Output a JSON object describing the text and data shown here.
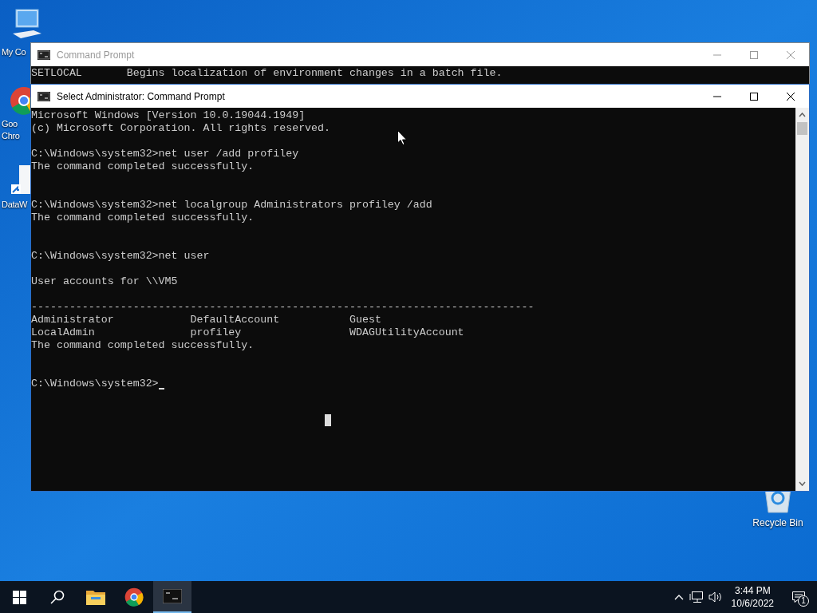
{
  "desktop_icons": [
    {
      "label": "My Co",
      "kind": "computer"
    },
    {
      "label": "Goo\nChro",
      "kind": "chrome"
    },
    {
      "label": "DataW",
      "kind": "file"
    },
    {
      "label": "Recycle Bin",
      "kind": "recycle"
    }
  ],
  "back_window": {
    "title": "Command Prompt",
    "lines": [
      "SETLOCAL       Begins localization of environment changes in a batch file."
    ]
  },
  "front_window": {
    "title": "Select Administrator: Command Prompt",
    "lines": [
      {
        "kind": "text",
        "text": "Microsoft Windows [Version 10.0.19044.1949]"
      },
      {
        "kind": "text",
        "text": "(c) Microsoft Corporation. All rights reserved."
      },
      {
        "kind": "blank"
      },
      {
        "kind": "text",
        "text": "C:\\Windows\\system32>net user /add profiley"
      },
      {
        "kind": "text",
        "text": "The command completed successfully."
      },
      {
        "kind": "blank"
      },
      {
        "kind": "blank"
      },
      {
        "kind": "text",
        "text": "C:\\Windows\\system32>net localgroup Administrators profiley /add"
      },
      {
        "kind": "text",
        "text": "The command completed successfully."
      },
      {
        "kind": "blank"
      },
      {
        "kind": "blank"
      },
      {
        "kind": "text",
        "text": "C:\\Windows\\system32>net user"
      },
      {
        "kind": "blank"
      },
      {
        "kind": "text",
        "text": "User accounts for \\\\VM5"
      },
      {
        "kind": "blank"
      },
      {
        "kind": "text",
        "text": "-------------------------------------------------------------------------------"
      },
      {
        "kind": "text",
        "text": "Administrator            DefaultAccount           Guest"
      },
      {
        "kind": "text",
        "text": "LocalAdmin               profiley                 WDAGUtilityAccount"
      },
      {
        "kind": "text",
        "text": "The command completed successfully."
      },
      {
        "kind": "blank"
      },
      {
        "kind": "blank"
      },
      {
        "kind": "prompt",
        "text": "C:\\Windows\\system32>"
      }
    ]
  },
  "taskbar": {
    "items": [
      {
        "kind": "start"
      },
      {
        "kind": "search"
      },
      {
        "kind": "explorer"
      },
      {
        "kind": "chrome"
      },
      {
        "kind": "cmd",
        "selected": true
      }
    ],
    "time": "3:44 PM",
    "date": "10/6/2022",
    "notification_count": "1"
  }
}
